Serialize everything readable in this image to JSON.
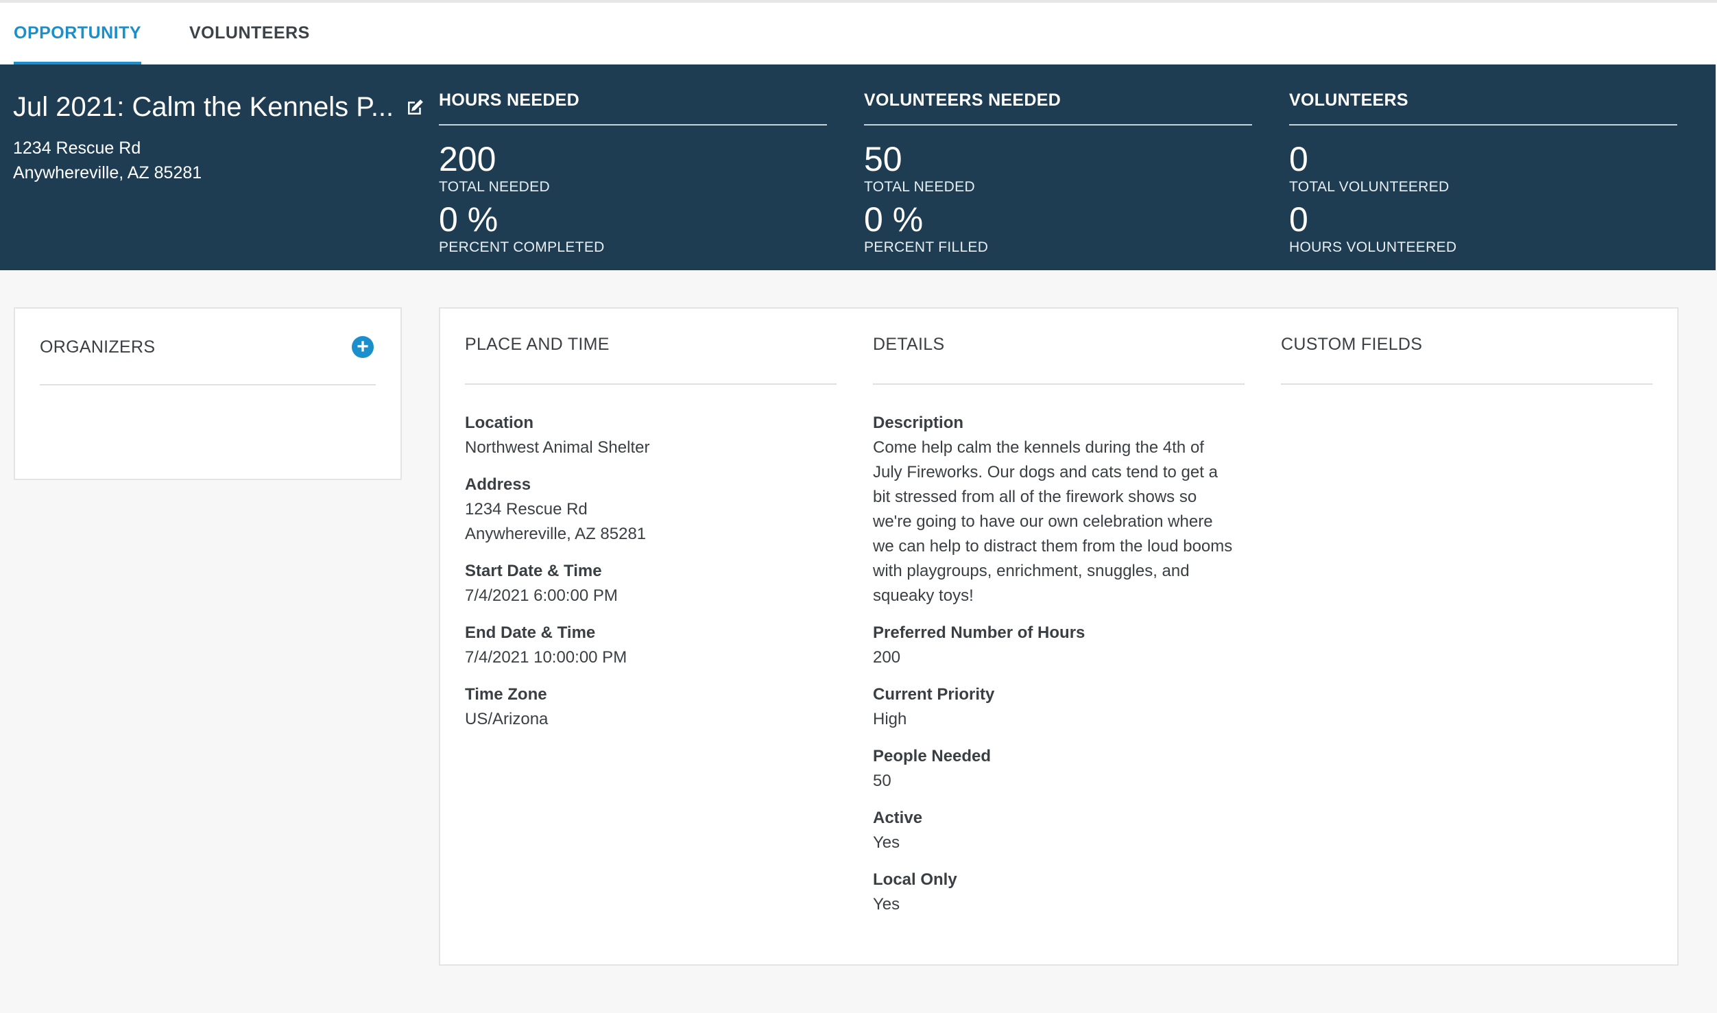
{
  "tabs": [
    {
      "label": "OPPORTUNITY",
      "active": true
    },
    {
      "label": "VOLUNTEERS",
      "active": false
    }
  ],
  "header": {
    "title": "Jul 2021: Calm the Kennels P...",
    "address_line1": "1234 Rescue Rd",
    "address_line2": "Anywhereville, AZ 85281",
    "stats": [
      {
        "heading": "HOURS NEEDED",
        "value1": "200",
        "label1": "TOTAL NEEDED",
        "value2": "0 %",
        "label2": "PERCENT COMPLETED"
      },
      {
        "heading": "VOLUNTEERS NEEDED",
        "value1": "50",
        "label1": "TOTAL NEEDED",
        "value2": "0 %",
        "label2": "PERCENT FILLED"
      },
      {
        "heading": "VOLUNTEERS",
        "value1": "0",
        "label1": "TOTAL VOLUNTEERED",
        "value2": "0",
        "label2": "HOURS VOLUNTEERED"
      }
    ]
  },
  "organizers": {
    "heading": "ORGANIZERS",
    "add_icon": "plus-circle-icon"
  },
  "place_and_time": {
    "heading": "PLACE AND TIME",
    "fields": [
      {
        "label": "Location",
        "value": "Northwest Animal Shelter"
      },
      {
        "label": "Address",
        "value": "1234 Rescue Rd",
        "value2": "Anywhereville, AZ 85281"
      },
      {
        "label": "Start Date & Time",
        "value": "7/4/2021 6:00:00 PM"
      },
      {
        "label": "End Date & Time",
        "value": "7/4/2021 10:00:00 PM"
      },
      {
        "label": "Time Zone",
        "value": "US/Arizona"
      }
    ]
  },
  "details": {
    "heading": "DETAILS",
    "description_label": "Description",
    "description_lines": [
      "Come help calm the kennels during the 4th of",
      "July Fireworks. Our dogs and cats tend to get a",
      "bit stressed from all of the firework shows so",
      "we're going to have our own celebration where",
      "we can help to distract them from the loud booms",
      "with playgroups, enrichment, snuggles, and",
      "squeaky toys!"
    ],
    "fields": [
      {
        "label": "Preferred Number of Hours",
        "value": "200"
      },
      {
        "label": "Current Priority",
        "value": "High"
      },
      {
        "label": "People Needed",
        "value": "50"
      },
      {
        "label": "Active",
        "value": "Yes"
      },
      {
        "label": "Local Only",
        "value": "Yes"
      }
    ]
  },
  "custom_fields": {
    "heading": "CUSTOM FIELDS"
  },
  "colors": {
    "accent": "#1a8fcb",
    "header_bg": "#1e3d52"
  }
}
